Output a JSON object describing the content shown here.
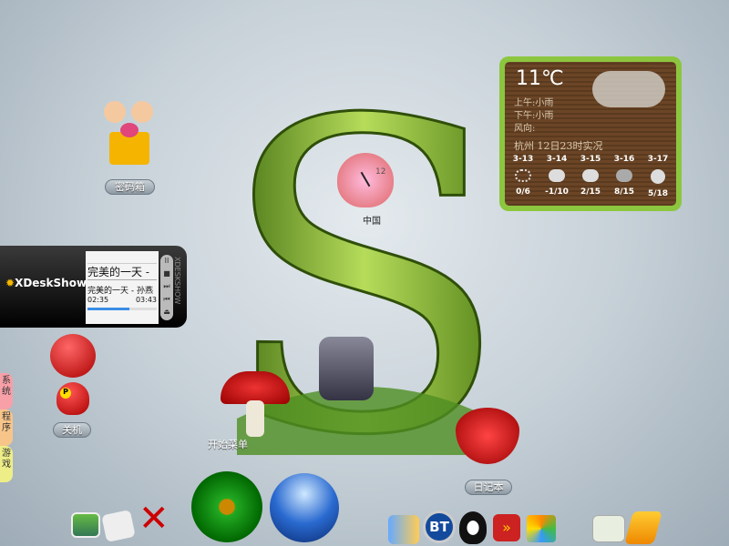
{
  "desktop": {
    "password_box": "密码箱",
    "clock_label": "中国",
    "clock_number": "12",
    "start_menu": "开始菜单",
    "diary": "日记本",
    "shutdown": "关机",
    "centerpiece_letter": "S"
  },
  "side_tabs": [
    "系统",
    "程序",
    "游戏"
  ],
  "weather": {
    "temp": "11℃",
    "morning": "上午:小雨",
    "afternoon": "下午:小雨",
    "wind": "风向:",
    "location": "杭州  12日23时实况",
    "forecast": [
      {
        "date": "3-13",
        "range": "0/6",
        "icon": "snow-icon"
      },
      {
        "date": "3-14",
        "range": "-1/10",
        "icon": "cloudy-icon"
      },
      {
        "date": "3-15",
        "range": "2/15",
        "icon": "cloudy-icon"
      },
      {
        "date": "3-16",
        "range": "8/15",
        "icon": "rain-cloud-icon"
      },
      {
        "date": "3-17",
        "range": "5/18",
        "icon": "moon-icon"
      }
    ]
  },
  "player": {
    "brand": "XDeskShow",
    "title_big": "完美的一天 -",
    "track": "完美的一天 - 孙燕",
    "elapsed": "02:35",
    "total": "03:43",
    "progress": 0.6,
    "side_text": "XDESKSHOW",
    "controls": [
      "II",
      "■",
      "⏭",
      "⏮",
      "⏏"
    ]
  },
  "dock": {
    "bt_label": "BT"
  },
  "colors": {
    "weather_frame": "#8cc63f",
    "s_green": "#6a9a1e"
  }
}
